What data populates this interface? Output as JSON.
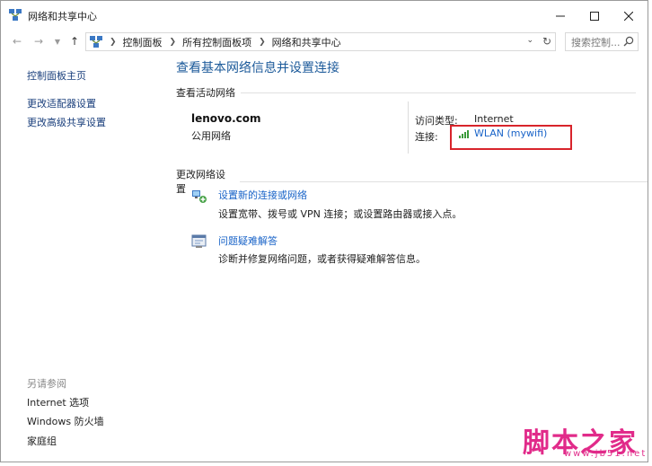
{
  "window": {
    "title": "网络和共享中心",
    "controls": {
      "minimize": "—",
      "maximize": "☐",
      "close": "✕"
    }
  },
  "address": {
    "breadcrumbs": [
      "控制面板",
      "所有控制面板项",
      "网络和共享中心"
    ],
    "search_placeholder": "搜索控制..."
  },
  "sidebar": {
    "items": [
      {
        "label": "控制面板主页"
      },
      {
        "label": "更改适配器设置"
      },
      {
        "label": "更改高级共享设置"
      }
    ],
    "see_also_title": "另请参阅",
    "see_also": [
      {
        "label": "Internet 选项"
      },
      {
        "label": "Windows 防火墙"
      },
      {
        "label": "家庭组"
      }
    ]
  },
  "main": {
    "title": "查看基本网络信息并设置连接",
    "active_section_title": "查看活动网络",
    "network": {
      "name": "lenovo.com",
      "category": "公用网络",
      "access_type_label": "访问类型:",
      "access_type_value": "Internet",
      "connection_label": "连接:",
      "connection_value": "WLAN (mywifi)"
    },
    "change_section_title": "更改网络设置",
    "tasks": [
      {
        "link": "设置新的连接或网络",
        "desc": "设置宽带、拨号或 VPN 连接；或设置路由器或接入点。"
      },
      {
        "link": "问题疑难解答",
        "desc": "诊断并修复网络问题，或者获得疑难解答信息。"
      }
    ]
  },
  "watermark": {
    "big": "脚本之家",
    "small": "www.jb51.net"
  },
  "colors": {
    "link": "#1a64c8",
    "title": "#1c5a9a",
    "highlight": "#d8242b",
    "watermark": "#e12b8a"
  }
}
